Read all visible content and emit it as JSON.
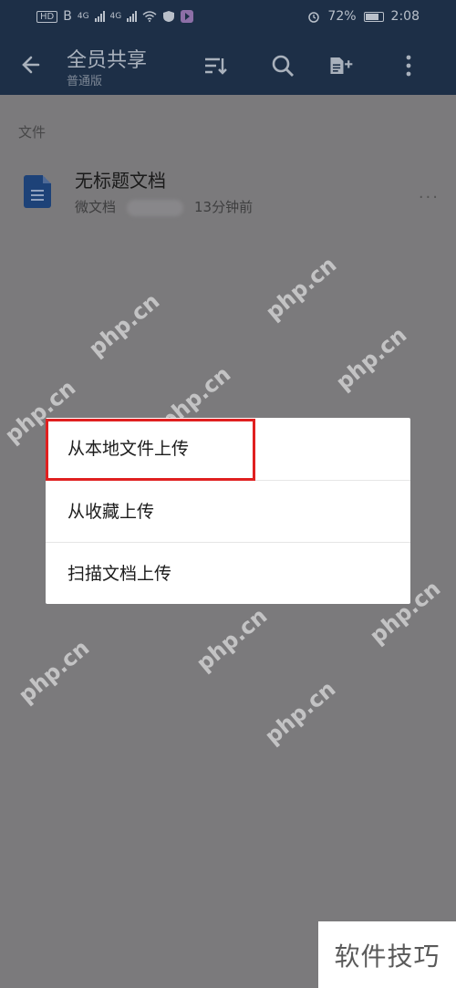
{
  "status_bar": {
    "network_chip": "HD",
    "network_sub": "B",
    "signal1": "4G",
    "signal2": "4G",
    "battery": "72%",
    "time": "2:08"
  },
  "app_bar": {
    "title": "全员共享",
    "subtitle": "普通版"
  },
  "section": {
    "label": "文件"
  },
  "file": {
    "name": "无标题文档",
    "type": "微文档",
    "time": "13分钟前",
    "more": "···"
  },
  "menu": {
    "items": [
      {
        "label": "从本地文件上传",
        "highlighted": true
      },
      {
        "label": "从收藏上传"
      },
      {
        "label": "扫描文档上传"
      }
    ]
  },
  "watermark": {
    "text": "php.cn",
    "corner": "软件技巧"
  },
  "colors": {
    "header": "#1d2f47",
    "overlay": "#7b7a7c",
    "highlight": "#e02020"
  }
}
